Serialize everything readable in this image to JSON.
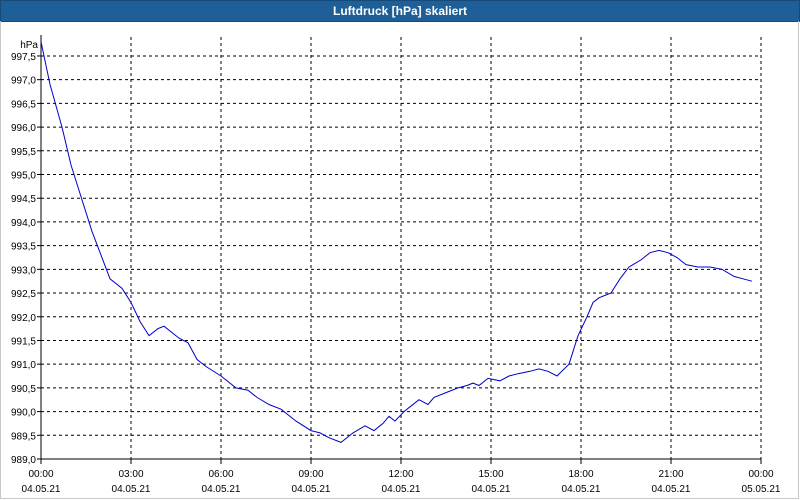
{
  "window": {
    "title": "Luftdruck [hPa] skaliert"
  },
  "chart_data": {
    "type": "line",
    "title": "Luftdruck [hPa] skaliert",
    "ylabel": "hPa",
    "xlabel": "",
    "grid": true,
    "ylim": [
      989.0,
      997.9
    ],
    "y_ticks": [
      "989,0",
      "989,5",
      "990,0",
      "990,5",
      "991,0",
      "991,5",
      "992,0",
      "992,5",
      "993,0",
      "993,5",
      "994,0",
      "994,5",
      "995,0",
      "995,5",
      "996,0",
      "996,5",
      "997,0",
      "997,5"
    ],
    "y_tick_values": [
      989.0,
      989.5,
      990.0,
      990.5,
      991.0,
      991.5,
      992.0,
      992.5,
      993.0,
      993.5,
      994.0,
      994.5,
      995.0,
      995.5,
      996.0,
      996.5,
      997.0,
      997.5
    ],
    "x_ticks": [
      {
        "hour": 0,
        "time": "00:00",
        "date": "04.05.21"
      },
      {
        "hour": 3,
        "time": "03:00",
        "date": "04.05.21"
      },
      {
        "hour": 6,
        "time": "06:00",
        "date": "04.05.21"
      },
      {
        "hour": 9,
        "time": "09:00",
        "date": "04.05.21"
      },
      {
        "hour": 12,
        "time": "12:00",
        "date": "04.05.21"
      },
      {
        "hour": 15,
        "time": "15:00",
        "date": "04.05.21"
      },
      {
        "hour": 18,
        "time": "18:00",
        "date": "04.05.21"
      },
      {
        "hour": 21,
        "time": "21:00",
        "date": "04.05.21"
      },
      {
        "hour": 24,
        "time": "00:00",
        "date": "05.05.21"
      }
    ],
    "xlim_hours": [
      0,
      24
    ],
    "series": [
      {
        "color": "#0000cc",
        "x_hours": [
          0,
          0.3,
          0.7,
          1.0,
          1.3,
          1.7,
          2.0,
          2.3,
          2.7,
          3.0,
          3.3,
          3.6,
          3.9,
          4.1,
          4.3,
          4.6,
          4.9,
          5.2,
          5.5,
          6.0,
          6.5,
          6.9,
          7.2,
          7.6,
          8.0,
          8.5,
          9.0,
          9.3,
          9.6,
          10.0,
          10.4,
          10.8,
          11.1,
          11.4,
          11.6,
          11.8,
          12.1,
          12.3,
          12.6,
          12.9,
          13.1,
          13.5,
          13.9,
          14.2,
          14.4,
          14.6,
          14.9,
          15.3,
          15.6,
          15.9,
          16.3,
          16.6,
          16.9,
          17.2,
          17.6,
          17.9,
          18.2,
          18.4,
          18.6,
          18.8,
          19.0,
          19.3,
          19.6,
          20.0,
          20.3,
          20.6,
          20.9,
          21.2,
          21.5,
          21.9,
          22.3,
          22.7,
          23.1,
          23.4,
          23.7
        ],
        "values": [
          997.8,
          996.9,
          996.0,
          995.2,
          994.6,
          993.8,
          993.3,
          992.8,
          992.6,
          992.3,
          991.9,
          991.6,
          991.75,
          991.8,
          991.7,
          991.55,
          991.45,
          991.1,
          990.95,
          990.75,
          990.5,
          990.45,
          990.3,
          990.15,
          990.05,
          989.8,
          989.6,
          989.55,
          989.45,
          989.35,
          989.55,
          989.7,
          989.6,
          989.75,
          989.9,
          989.8,
          990.0,
          990.1,
          990.25,
          990.15,
          990.3,
          990.4,
          990.5,
          990.55,
          990.6,
          990.55,
          990.7,
          990.65,
          990.75,
          990.8,
          990.85,
          990.9,
          990.85,
          990.75,
          991.0,
          991.6,
          992.0,
          992.3,
          992.4,
          992.45,
          992.5,
          992.8,
          993.05,
          993.2,
          993.35,
          993.4,
          993.35,
          993.25,
          993.1,
          993.05,
          993.05,
          993.0,
          992.85,
          992.8,
          992.75
        ]
      }
    ]
  }
}
